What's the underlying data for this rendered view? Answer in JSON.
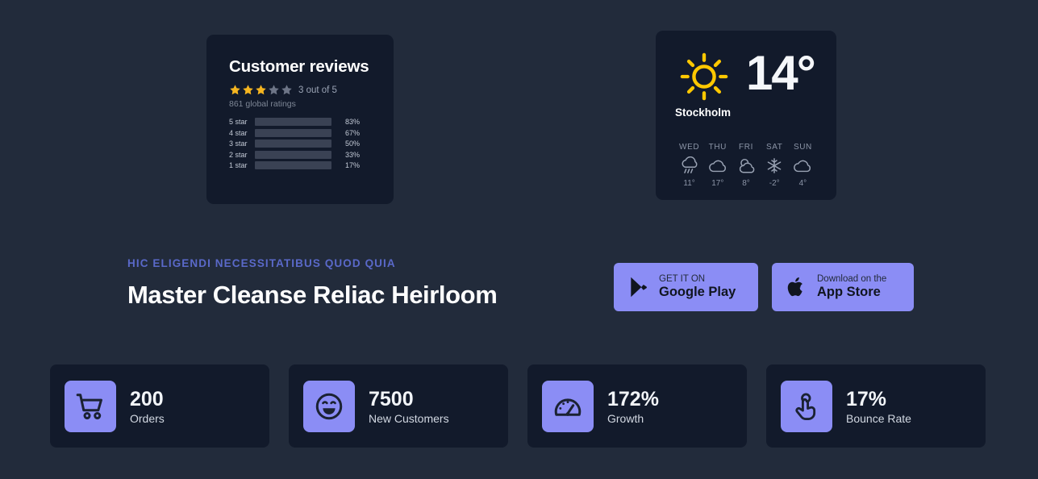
{
  "reviews": {
    "title": "Customer reviews",
    "stars_filled": 3,
    "stars_total": 5,
    "rating_text": "3 out of 5",
    "global_ratings": "861 global ratings",
    "star_color": "#f5b520",
    "star_empty_color": "#6d7587",
    "bar_color": "#fac284",
    "bars": [
      {
        "label": "5 star",
        "percent": 83,
        "percent_text": "83%"
      },
      {
        "label": "4 star",
        "percent": 67,
        "percent_text": "67%"
      },
      {
        "label": "3 star",
        "percent": 50,
        "percent_text": "50%"
      },
      {
        "label": "2 star",
        "percent": 33,
        "percent_text": "33%"
      },
      {
        "label": "1 star",
        "percent": 17,
        "percent_text": "17%"
      }
    ]
  },
  "weather": {
    "icon": "sun-icon",
    "city": "Stockholm",
    "temperature": "14°",
    "sun_color": "#ffc800",
    "forecast": [
      {
        "day": "WED",
        "icon": "rain-cloud-icon",
        "temp": "11°"
      },
      {
        "day": "THU",
        "icon": "cloud-icon",
        "temp": "17°"
      },
      {
        "day": "FRI",
        "icon": "partly-cloudy-icon",
        "temp": "8°"
      },
      {
        "day": "SAT",
        "icon": "snowflake-icon",
        "temp": "-2°"
      },
      {
        "day": "SUN",
        "icon": "cloud-icon",
        "temp": "4°"
      }
    ]
  },
  "hero": {
    "eyebrow": "HIC ELIGENDI NECESSITATIBUS QUOD QUIA",
    "headline": "Master Cleanse Reliac Heirloom",
    "accent_color": "#8b8df5",
    "eyebrow_color": "#5a69c9",
    "buttons": [
      {
        "icon": "google-play-icon",
        "small": "GET IT ON",
        "big": "Google Play"
      },
      {
        "icon": "apple-icon",
        "small": "Download on the",
        "big": "App Store"
      }
    ]
  },
  "stats": [
    {
      "icon": "shopping-cart-icon",
      "value": "200",
      "label": "Orders"
    },
    {
      "icon": "smiley-face-icon",
      "value": "7500",
      "label": "New Customers"
    },
    {
      "icon": "gauge-icon",
      "value": "172%",
      "label": "Growth"
    },
    {
      "icon": "tap-hand-icon",
      "value": "17%",
      "label": "Bounce Rate"
    }
  ]
}
